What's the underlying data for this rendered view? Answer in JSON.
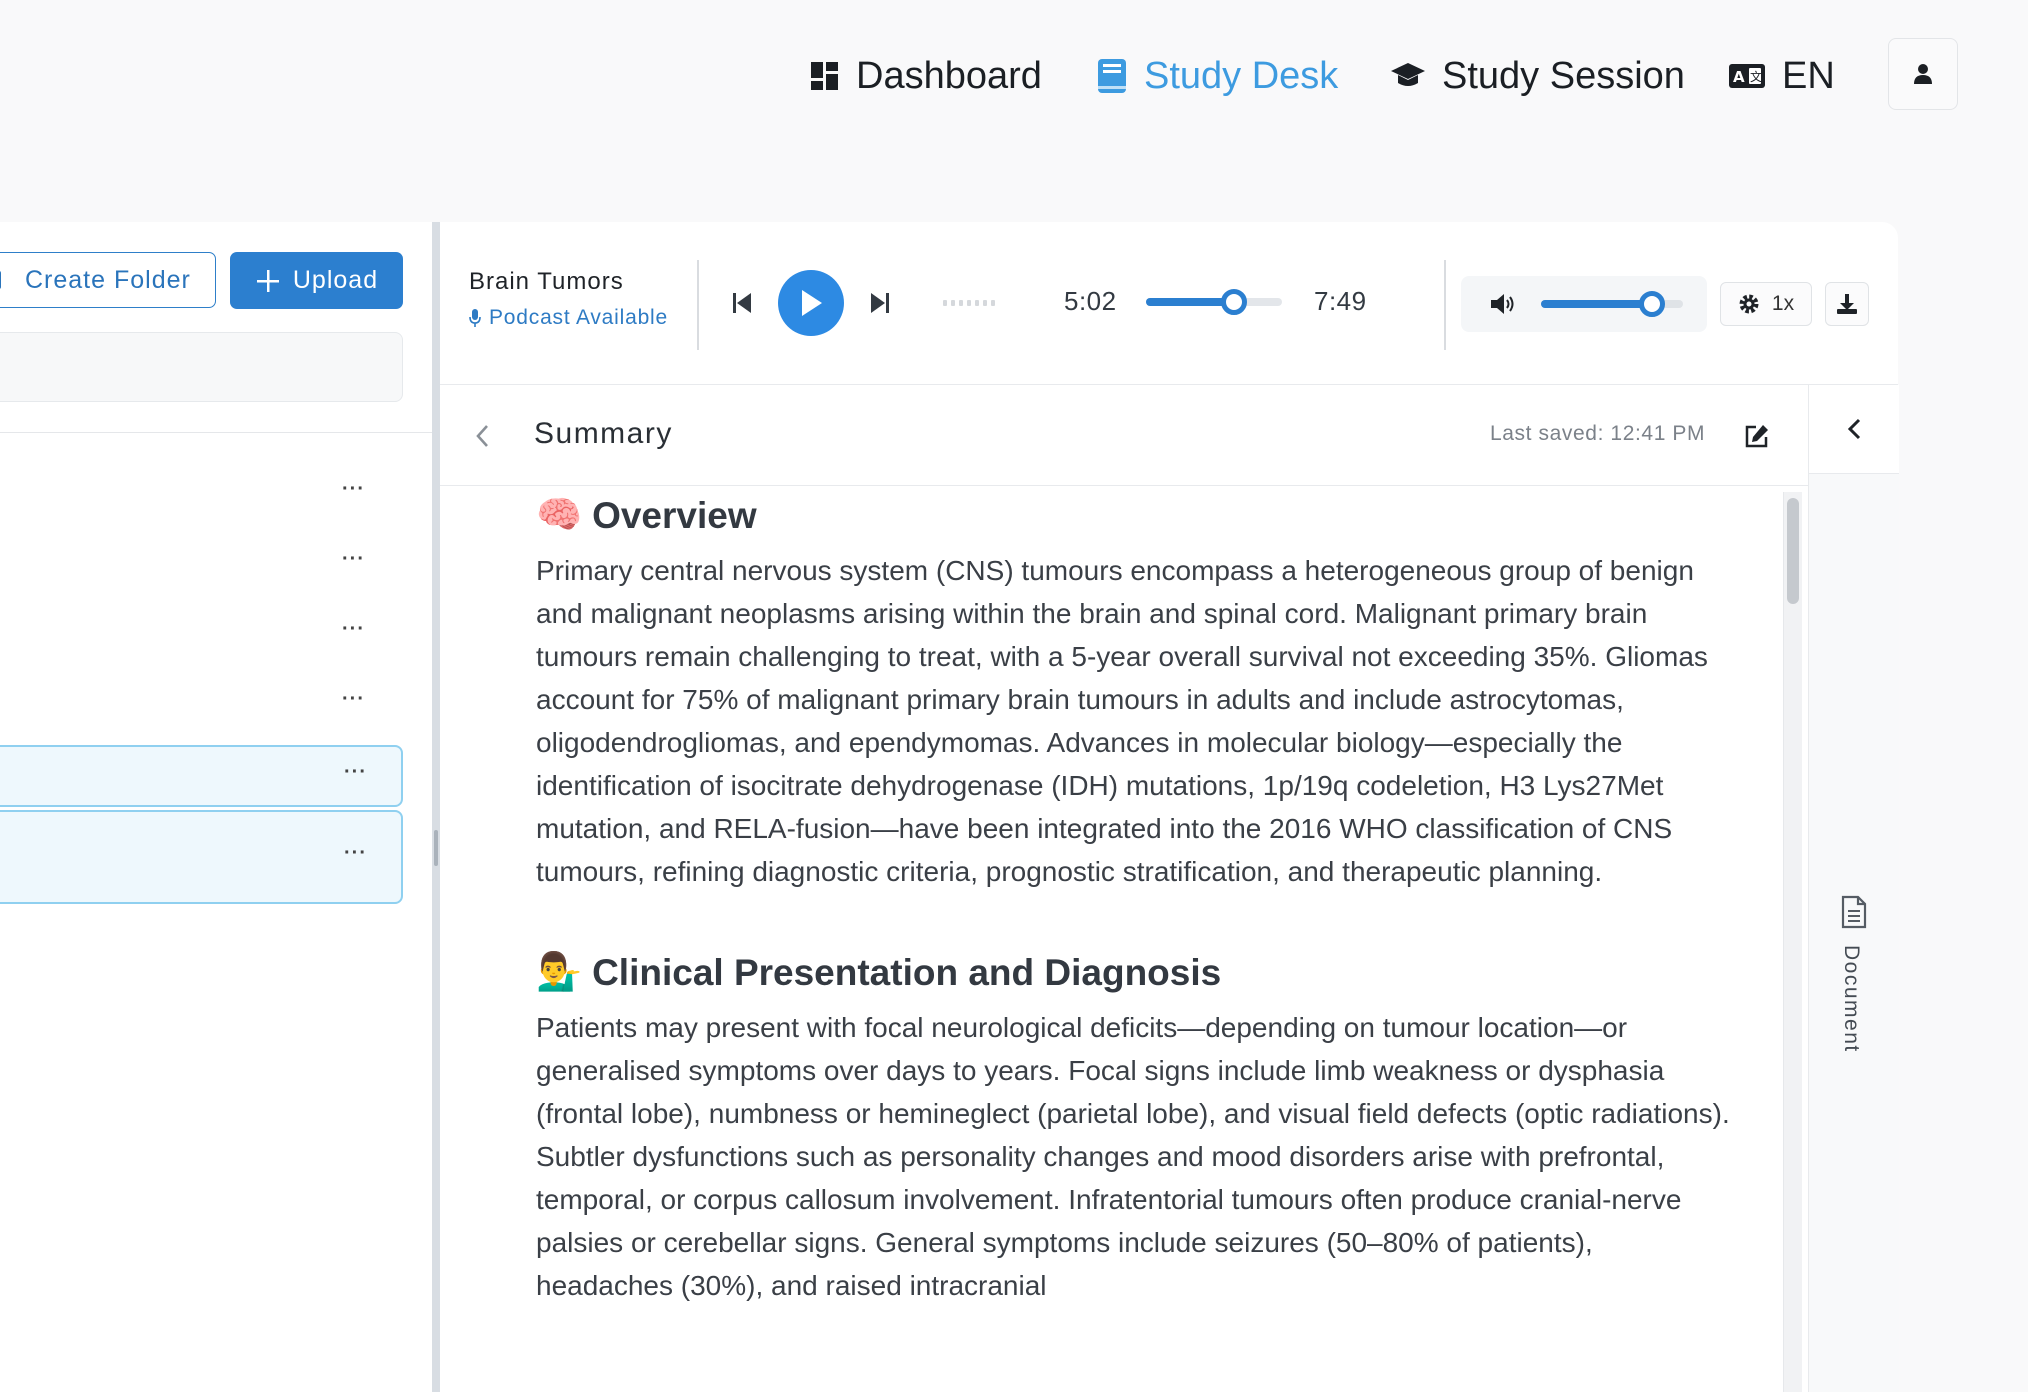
{
  "nav": {
    "dashboard": "Dashboard",
    "study_desk": "Study Desk",
    "study_session": "Study Session",
    "language": "EN",
    "active_color": "#3d9be0"
  },
  "sidebar": {
    "create_folder": "Create Folder",
    "upload": "Upload",
    "row_menu": "···"
  },
  "player": {
    "title": "Brain Tumors",
    "subtitle": "Podcast Available",
    "current_time": "5:02",
    "total_time": "7:49",
    "progress_fraction": 0.645,
    "volume_fraction": 0.78,
    "speed": "1x"
  },
  "summary": {
    "title": "Summary",
    "last_saved": "Last saved: 12:41 PM",
    "side_label": "Document"
  },
  "content": {
    "sections": [
      {
        "emoji": "🧠",
        "heading": "Overview",
        "text": "Primary central nervous system (CNS) tumours encompass a heterogeneous group of benign and malignant neoplasms arising within the brain and spinal cord. Malignant primary brain tumours remain challenging to treat, with a 5-year overall survival not exceeding 35%. Gliomas account for 75% of malignant primary brain tumours in adults and include astrocytomas, oligodendrogliomas, and ependymomas. Advances in molecular biology—especially the identification of isocitrate dehydrogenase (IDH) mutations, 1p/19q codeletion, H3 Lys27Met mutation, and RELA-fusion—have been integrated into the 2016 WHO classification of CNS tumours, refining diagnostic criteria, prognostic stratification, and therapeutic planning."
      },
      {
        "emoji": "💁‍♂️",
        "heading": "Clinical Presentation and Diagnosis",
        "text": "Patients may present with focal neurological deficits—depending on tumour location—or generalised symptoms over days to years. Focal signs include limb weakness or dysphasia (frontal lobe), numbness or hemineglect (parietal lobe), and visual field defects (optic radiations). Subtler dysfunctions such as personality changes and mood disorders arise with prefrontal, temporal, or corpus callosum involvement. Infratentorial tumours often produce cranial-nerve palsies or cerebellar signs. General symptoms include seizures (50–80% of patients), headaches (30%), and raised intracranial"
      }
    ]
  }
}
